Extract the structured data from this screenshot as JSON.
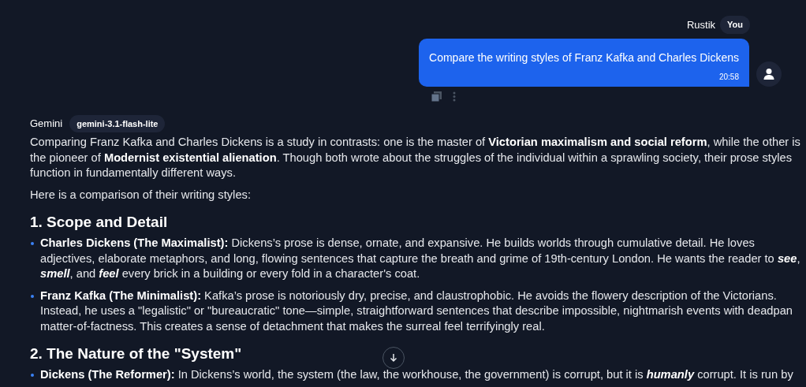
{
  "user_message": {
    "sender": "Rustik",
    "badge": "You",
    "text": "Compare the writing styles of Franz Kafka and Charles Dickens",
    "time": "20:58"
  },
  "assistant_message": {
    "sender": "Gemini",
    "model": "gemini-3.1-flash-lite",
    "blocks": [
      {
        "kind": "paragraph",
        "text": "Comparing Franz Kafka and Charles Dickens is a study in contrasts: one is the master of **Victorian maximalism and social reform**, while the other is the pioneer of **Modernist existential alienation**. Though both wrote about the struggles of the individual within a sprawling society, their prose styles function in fundamentally different ways."
      },
      {
        "kind": "paragraph",
        "text": "Here is a comparison of their writing styles:"
      },
      {
        "kind": "heading",
        "text": "1. Scope and Detail"
      },
      {
        "kind": "bullet",
        "text": "**Charles Dickens (The Maximalist):** Dickens’s prose is dense, ornate, and expansive. He builds worlds through cumulative detail. He loves adjectives, elaborate metaphors, and long, flowing sentences that capture the breath and grime of 19th-century London. He wants the reader to *see*, *smell*, and *feel* every brick in a building or every fold in a character's coat."
      },
      {
        "kind": "bullet",
        "text": "**Franz Kafka (The Minimalist):** Kafka’s prose is notoriously dry, precise, and claustrophobic. He avoids the flowery description of the Victorians. Instead, he uses a \"legalistic\" or \"bureaucratic\" tone—simple, straightforward sentences that describe impossible, nightmarish events with deadpan matter-of-factness. This creates a sense of detachment that makes the surreal feel terrifyingly real."
      },
      {
        "kind": "heading",
        "text": "2. The Nature of the \"System\""
      },
      {
        "kind": "bullet",
        "text": "**Dickens (The Reformer):** In Dickens’s world, the system (the law, the workhouse, the government) is corrupt, but it is *humanly* corrupt. It is run by"
      }
    ]
  }
}
